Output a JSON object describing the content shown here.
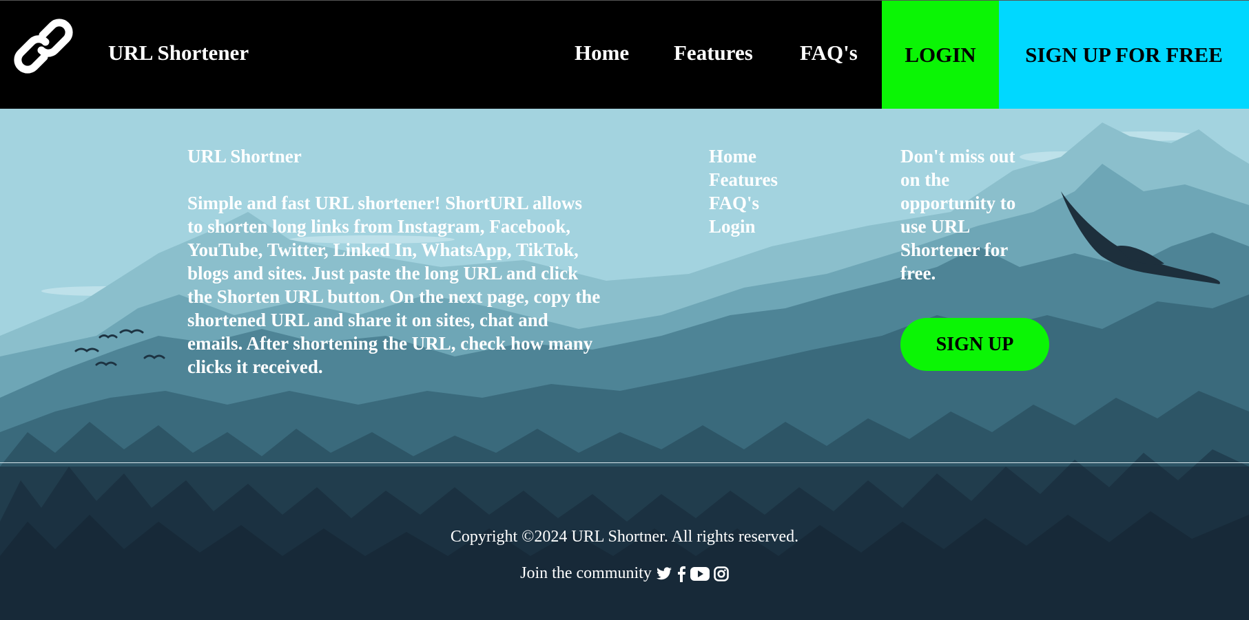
{
  "header": {
    "brand": "URL Shortener",
    "nav": [
      {
        "label": "Home"
      },
      {
        "label": "Features"
      },
      {
        "label": "FAQ's"
      }
    ],
    "login_label": "LOGIN",
    "signup_label": "SIGN UP FOR FREE",
    "logo_icon": "link-icon"
  },
  "footer": {
    "about_title": "URL Shortner",
    "about_text": "Simple and fast URL shortener! ShortURL allows to shorten long links from Instagram, Facebook, YouTube, Twitter, Linked In, WhatsApp, TikTok, blogs and sites. Just paste the long URL and click the Shorten URL button. On the next page, copy the shortened URL and share it on sites, chat and emails. After shortening the URL, check how many clicks it received.",
    "links": [
      {
        "label": "Home"
      },
      {
        "label": "Features"
      },
      {
        "label": "FAQ's"
      },
      {
        "label": "Login"
      }
    ],
    "cta_text": "Don't miss out on the opportunity to use URL Shortener for free.",
    "cta_button": "SIGN UP",
    "copyright": "Copyright ©2024 URL Shortner. All rights reserved.",
    "community_label": "Join the community",
    "social_icons": [
      "twitter-icon",
      "facebook-icon",
      "youtube-icon",
      "instagram-icon"
    ]
  },
  "colors": {
    "header_bg": "#000000",
    "login_bg": "#0bf505",
    "signup_bg": "#00d8ff",
    "cta_button_bg": "#0bf505",
    "sky": "#a3d3df",
    "footer_bg": "#14222f"
  }
}
